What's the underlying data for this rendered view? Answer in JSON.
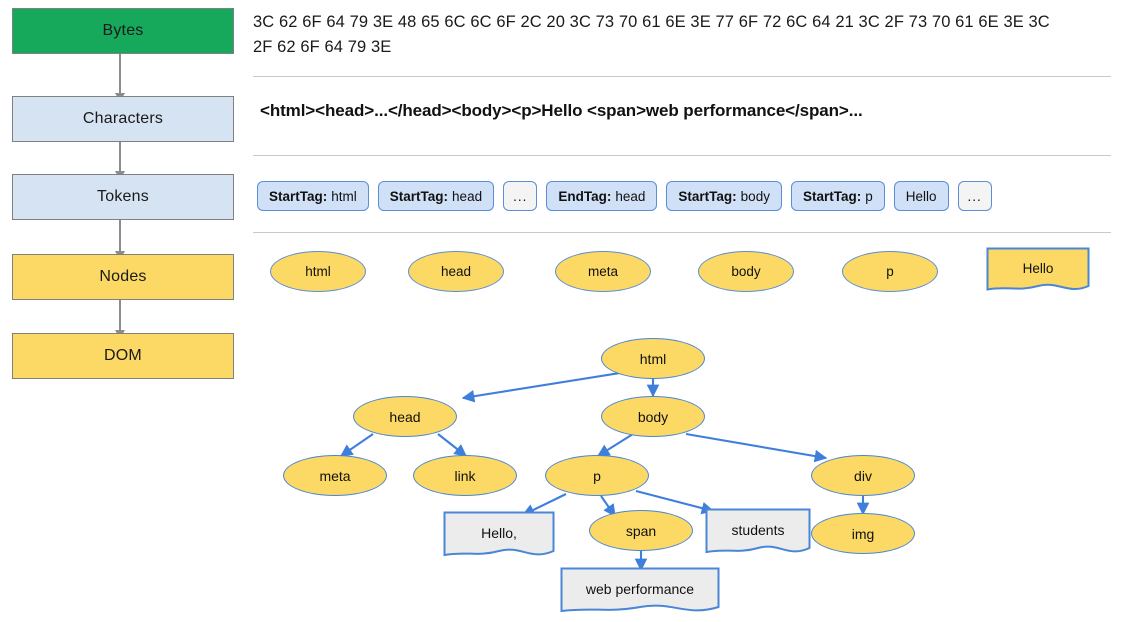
{
  "pipeline": {
    "stages": [
      {
        "label": "Bytes",
        "color": "#17a95b"
      },
      {
        "label": "Characters",
        "color": "#d6e3f2"
      },
      {
        "label": "Tokens",
        "color": "#d6e3f2"
      },
      {
        "label": "Nodes",
        "color": "#fcd964"
      },
      {
        "label": "DOM",
        "color": "#fcd964"
      }
    ]
  },
  "bytes_row": {
    "text": "3C 62 6F 64 79 3E 48 65 6C 6C 6F 2C 20 3C 73 70 61 6E 3E 77 6F 72 6C 64 21 3C 2F 73 70 61 6E 3E 3C 2F 62 6F 64 79 3E"
  },
  "characters_row": {
    "text": "<html><head>...</head><body><p>Hello <span>web performance</span>..."
  },
  "tokens_row": {
    "tokens": [
      {
        "prefix": "StartTag:",
        "value": "html",
        "kind": "tag"
      },
      {
        "prefix": "StartTag:",
        "value": "head",
        "kind": "tag"
      },
      {
        "prefix": "",
        "value": "...",
        "kind": "ellipsis"
      },
      {
        "prefix": "EndTag:",
        "value": "head",
        "kind": "tag"
      },
      {
        "prefix": "StartTag:",
        "value": "body",
        "kind": "tag"
      },
      {
        "prefix": "StartTag:",
        "value": "p",
        "kind": "tag"
      },
      {
        "prefix": "",
        "value": "Hello",
        "kind": "text"
      },
      {
        "prefix": "",
        "value": "...",
        "kind": "ellipsis"
      }
    ]
  },
  "nodes_row": {
    "nodes": [
      {
        "label": "html",
        "shape": "ellipse"
      },
      {
        "label": "head",
        "shape": "ellipse"
      },
      {
        "label": "meta",
        "shape": "ellipse"
      },
      {
        "label": "body",
        "shape": "ellipse"
      },
      {
        "label": "p",
        "shape": "ellipse"
      },
      {
        "label": "Hello",
        "shape": "document"
      }
    ]
  },
  "dom_tree": {
    "nodes": [
      {
        "id": "html",
        "label": "html",
        "shape": "ellipse"
      },
      {
        "id": "head",
        "label": "head",
        "shape": "ellipse"
      },
      {
        "id": "body",
        "label": "body",
        "shape": "ellipse"
      },
      {
        "id": "meta",
        "label": "meta",
        "shape": "ellipse"
      },
      {
        "id": "link",
        "label": "link",
        "shape": "ellipse"
      },
      {
        "id": "p",
        "label": "p",
        "shape": "ellipse"
      },
      {
        "id": "div",
        "label": "div",
        "shape": "ellipse"
      },
      {
        "id": "hello",
        "label": "Hello,",
        "shape": "document"
      },
      {
        "id": "span",
        "label": "span",
        "shape": "ellipse"
      },
      {
        "id": "students",
        "label": "students",
        "shape": "document"
      },
      {
        "id": "img",
        "label": "img",
        "shape": "ellipse"
      },
      {
        "id": "webperf",
        "label": "web performance",
        "shape": "document"
      }
    ],
    "edges": [
      {
        "from": "html",
        "to": "head"
      },
      {
        "from": "html",
        "to": "body"
      },
      {
        "from": "head",
        "to": "meta"
      },
      {
        "from": "head",
        "to": "link"
      },
      {
        "from": "body",
        "to": "p"
      },
      {
        "from": "body",
        "to": "div"
      },
      {
        "from": "p",
        "to": "hello"
      },
      {
        "from": "p",
        "to": "span"
      },
      {
        "from": "p",
        "to": "students"
      },
      {
        "from": "div",
        "to": "img"
      },
      {
        "from": "span",
        "to": "webperf"
      }
    ]
  },
  "colors": {
    "green": "#17a95b",
    "light_blue": "#d6e3f2",
    "yellow": "#fcd964",
    "node_border": "#4a86d6",
    "edge": "#3f7fdb",
    "text_node_fill": "#ececec",
    "divider": "#c9c9c9"
  }
}
